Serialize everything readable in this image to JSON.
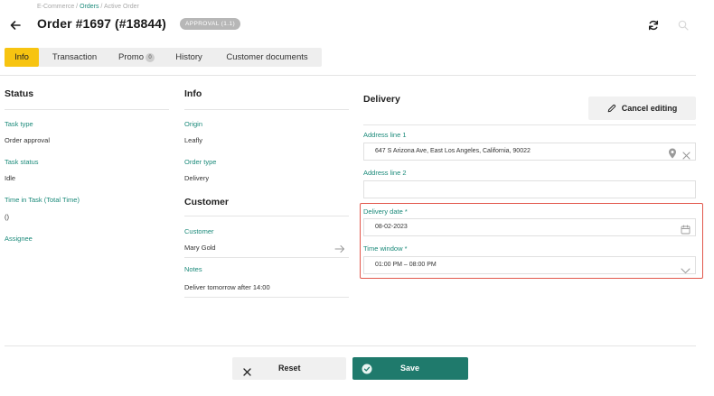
{
  "header": {
    "breadcrumb": {
      "root": "E-Commerce",
      "sep1": " / ",
      "section": "Orders",
      "sep2": " / ",
      "current": "Active Order"
    },
    "title": "Order #1697 (#18844)",
    "status_pill": "APPROVAL (1.1)"
  },
  "tabs": [
    {
      "label": "Info",
      "active": true
    },
    {
      "label": "Transaction"
    },
    {
      "label": "Promo",
      "count": "0"
    },
    {
      "label": "History"
    },
    {
      "label": "Customer documents"
    }
  ],
  "status_section": {
    "heading": "Status",
    "task_type_label": "Task type",
    "task_type_value": "Order approval",
    "task_status_label": "Task status",
    "task_status_value": "Idle",
    "time_in_task_label": "Time in Task (Total Time)",
    "time_in_task_value": "()",
    "assignee_label": "Assignee"
  },
  "info_section": {
    "heading": "Info",
    "origin_label": "Origin",
    "origin_value": "Leafly",
    "order_type_label": "Order type",
    "order_type_value": "Delivery"
  },
  "customer_section": {
    "heading": "Customer",
    "customer_label": "Customer",
    "customer_value": "Mary Gold",
    "notes_label": "Notes",
    "notes_value": "Deliver tomorrow after 14:00"
  },
  "delivery_section": {
    "heading": "Delivery",
    "cancel_editing_label": "Cancel editing",
    "address1_label": "Address line 1",
    "address1_value": "647 S Arizona Ave, East Los Angeles, California, 90022",
    "address2_label": "Address line 2",
    "address2_value": "",
    "delivery_date_label": "Delivery date *",
    "delivery_date_value": "08-02-2023",
    "time_window_label": "Time window *",
    "time_window_value": "01:00 PM – 08:00 PM"
  },
  "footer": {
    "reset_label": "Reset",
    "save_label": "Save"
  },
  "colors": {
    "accent_teal": "#1f7a6c",
    "label_teal": "#1b8a7a",
    "tab_active": "#f7c411",
    "highlight_red": "#e2574c"
  },
  "icons": {
    "back": "arrow-left-icon",
    "refresh": "refresh-icon",
    "search": "search-icon",
    "cancel_editing": "pencil-icon",
    "location": "map-pin-icon",
    "clear": "close-icon",
    "calendar": "calendar-icon",
    "dropdown": "chevron-down-icon",
    "customer_link": "arrow-right-icon",
    "reset": "close-icon",
    "save": "check-circle-icon"
  }
}
